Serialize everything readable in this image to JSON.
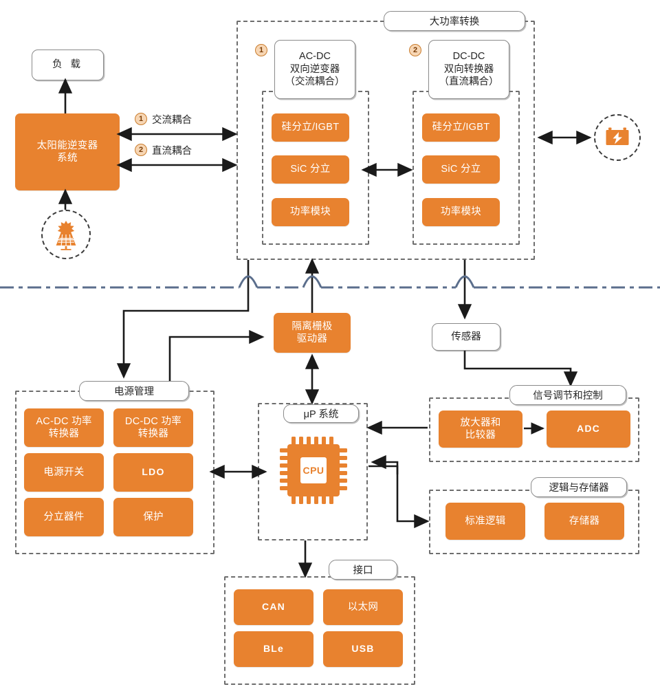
{
  "colors": {
    "accent_orange": "#E8822F",
    "box_border_gray": "#8A8A8A",
    "group_dash_gray": "#6D6D6D",
    "divider_blue": "#5B6E8C",
    "badge_fill": "#F7D6B4",
    "badge_border": "#C97C2C",
    "wire_black": "#1A1A1A"
  },
  "left": {
    "load_box": "负 载",
    "inverter_system": "太阳能逆变器\n系统",
    "inverter_system_line1": "太阳能逆变器",
    "inverter_system_line2": "系统",
    "solar_icon": "solar-panel-icon",
    "couplings": [
      {
        "num": "1",
        "label": "交流耦合"
      },
      {
        "num": "2",
        "label": "直流耦合"
      }
    ]
  },
  "high_power": {
    "group_title": "大功率转换",
    "battery_icon": "battery-icon",
    "blocks": [
      {
        "num": "1",
        "title_line1": "AC-DC",
        "title_line2": "双向逆变器",
        "title_line3": "（交流耦合）",
        "items": [
          "硅分立/IGBT",
          "SiC 分立",
          "功率模块"
        ]
      },
      {
        "num": "2",
        "title_line1": "DC-DC",
        "title_line2": "双向转换器",
        "title_line3": "（直流耦合）",
        "items": [
          "硅分立/IGBT",
          "SiC 分立",
          "功率模块"
        ]
      }
    ]
  },
  "mid": {
    "gate_driver_line1": "隔离栅极",
    "gate_driver_line2": "驱动器",
    "sensor": "传感器"
  },
  "power_management": {
    "group_title": "电源管理",
    "items": [
      {
        "label": "AC-DC 功率\n转换器",
        "line1": "AC-DC 功率",
        "line2": "转换器",
        "bold": false
      },
      {
        "label": "DC-DC 功率\n转换器",
        "line1": "DC-DC 功率",
        "line2": "转换器",
        "bold": false
      },
      {
        "label": "电源开关",
        "line1": "电源开关",
        "line2": "",
        "bold": false
      },
      {
        "label": "LDO",
        "line1": "LDO",
        "line2": "",
        "bold": true
      },
      {
        "label": "分立器件",
        "line1": "分立器件",
        "line2": "",
        "bold": false
      },
      {
        "label": "保护",
        "line1": "保护",
        "line2": "",
        "bold": false
      }
    ]
  },
  "mcu": {
    "group_title": "μP 系统",
    "cpu_label": "CPU",
    "cpu_icon": "cpu-chip-icon"
  },
  "signal": {
    "group_title": "信号调节和控制",
    "items": [
      {
        "line1": "放大器和",
        "line2": "比较器",
        "bold": false
      },
      {
        "line1": "ADC",
        "line2": "",
        "bold": true
      }
    ]
  },
  "logic_memory": {
    "group_title": "逻辑与存储器",
    "items": [
      {
        "line1": "标准逻辑",
        "line2": "",
        "bold": false
      },
      {
        "line1": "存储器",
        "line2": "",
        "bold": false
      }
    ]
  },
  "interface": {
    "group_title": "接口",
    "items": [
      {
        "line1": "CAN",
        "bold": true
      },
      {
        "line1": "以太网",
        "bold": false
      },
      {
        "line1": "BLe",
        "bold": true
      },
      {
        "line1": "USB",
        "bold": true
      }
    ]
  }
}
